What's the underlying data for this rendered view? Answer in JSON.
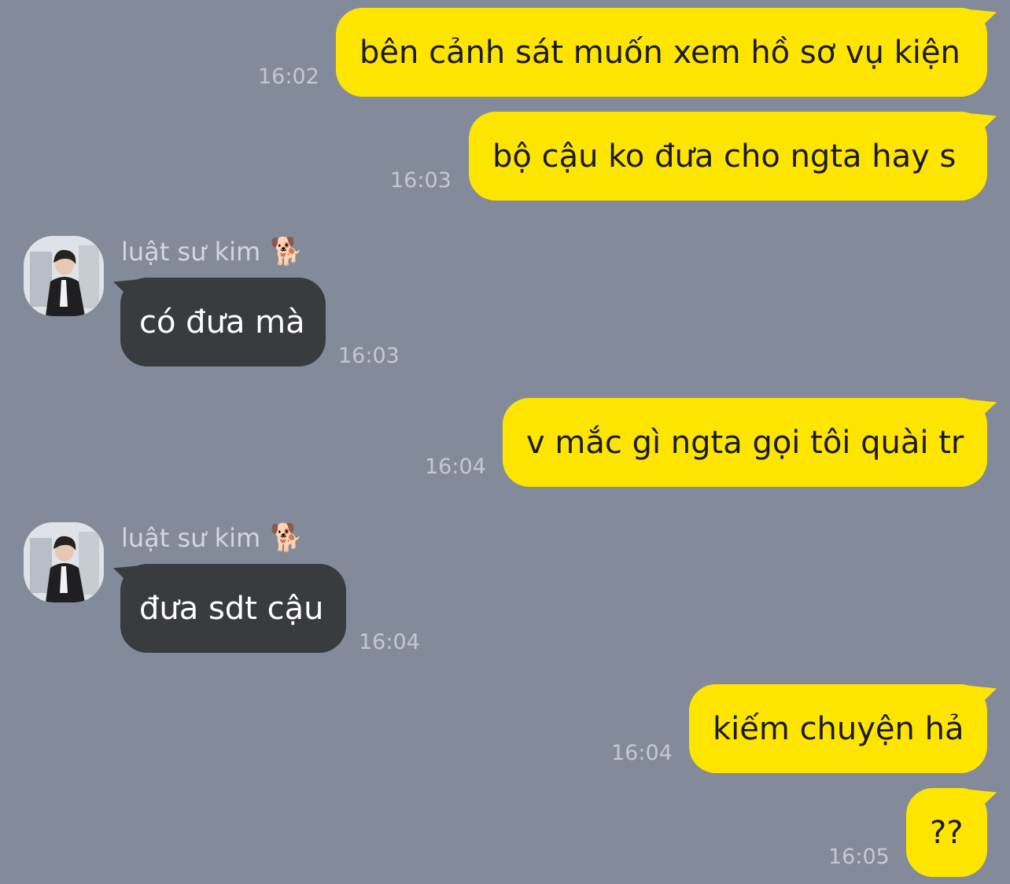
{
  "messages": [
    {
      "text": "bên cảnh sát muốn xem hồ sơ vụ kiện",
      "time": "16:02"
    },
    {
      "text": "bộ cậu ko đưa cho ngta hay s",
      "time": "16:03"
    },
    {
      "sender": "luật sư kim",
      "sender_emoji": "🐕",
      "text": "có đưa mà",
      "time": "16:03"
    },
    {
      "text": "v mắc gì ngta gọi tôi quài tr",
      "time": "16:04"
    },
    {
      "sender": "luật sư kim",
      "sender_emoji": "🐕",
      "text": "đưa sdt cậu",
      "time": "16:04"
    },
    {
      "text": "kiếm chuyện hả",
      "time": "16:04"
    },
    {
      "text": "??",
      "time": "16:05"
    }
  ],
  "icons": {
    "avatar": "avatar-photo-man-in-suit",
    "sender_emoji": "dog-icon"
  },
  "colors": {
    "background": "#838b9b",
    "my_bubble": "#fee500",
    "their_bubble": "#3a3b3f",
    "timestamp": "#c3c8d2"
  }
}
